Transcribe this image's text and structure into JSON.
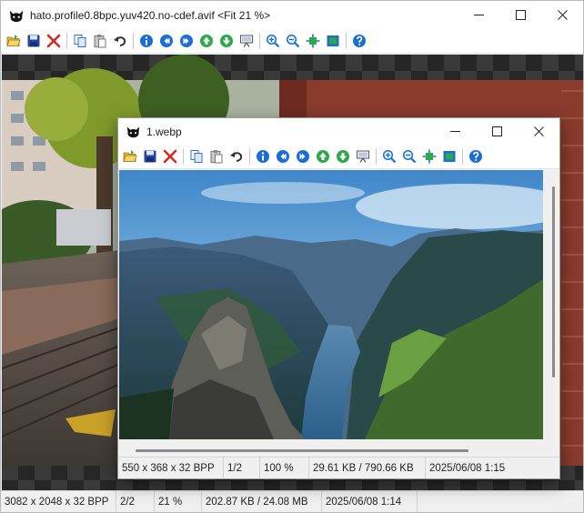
{
  "outer": {
    "title": "hato.profile0.8bpc.yuv420.no-cdef.avif <Fit 21 %>",
    "status": {
      "dimensions": "3082 x 2048 x 32 BPP",
      "page": "2/2",
      "zoom": "21 %",
      "filesize": "202.87 KB / 24.08 MB",
      "timestamp": "2025/06/08 1:14"
    }
  },
  "inner": {
    "title": "1.webp",
    "status": {
      "dimensions": "550 x 368 x 32 BPP",
      "page": "1/2",
      "zoom": "100 %",
      "filesize": "29.61 KB / 790.66 KB",
      "timestamp": "2025/06/08 1:15"
    }
  },
  "toolbar_icons": [
    "open-icon",
    "save-icon",
    "delete-icon",
    "copy-icon",
    "paste-icon",
    "undo-icon",
    "info-icon",
    "prev-icon",
    "next-icon",
    "up-icon",
    "down-icon",
    "slideshow-icon",
    "zoom-in-icon",
    "zoom-out-icon",
    "fit-icon",
    "fullscreen-icon",
    "help-icon"
  ],
  "colors": {
    "accent_blue": "#1b6fd2",
    "green": "#2ea84a",
    "red": "#d42a1e",
    "save_blue": "#2345a8"
  }
}
